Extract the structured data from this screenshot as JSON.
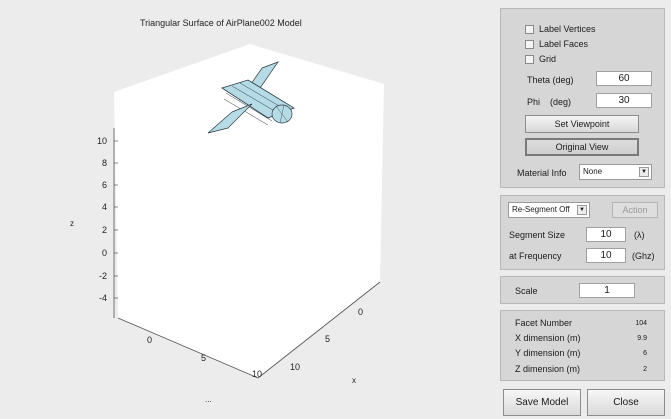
{
  "plot": {
    "title": "Triangular Surface of AirPlane002 Model",
    "z_label": "z",
    "x_label": "x",
    "y_label": "...",
    "z_ticks": [
      "10",
      "8",
      "6",
      "4",
      "2",
      "0",
      "-2",
      "-4"
    ],
    "x_ticks": [
      "0",
      "5",
      "10"
    ],
    "y_ticks": [
      "0",
      "5",
      "10"
    ],
    "fill_color": "#b4dbe6",
    "edge_color": "#2d3a40"
  },
  "view_panel": {
    "label_vertices": "Label Vertices",
    "label_faces": "Label Faces",
    "grid": "Grid",
    "theta_label": "Theta (deg)",
    "theta_value": "60",
    "phi_label": "Phi    (deg)",
    "phi_value": "30",
    "set_viewpoint": "Set Viewpoint",
    "original_view": "Original View",
    "material_label": "Material Info",
    "material_value": "None"
  },
  "segment_panel": {
    "resegment_value": "Re-Segment Off",
    "action": "Action",
    "segment_size_label": "Segment Size",
    "segment_size_value": "10",
    "segment_size_unit": "(λ)",
    "frequency_label": "at Frequency",
    "frequency_value": "10",
    "frequency_unit": "(Ghz)"
  },
  "scale_panel": {
    "label": "Scale",
    "value": "1"
  },
  "info_panel": {
    "facet_label": "Facet Number",
    "facet_value": "104",
    "x_label": "X dimension (m)",
    "x_value": "9.9",
    "y_label": "Y dimension (m)",
    "y_value": "6",
    "z_label": "Z dimension (m)",
    "z_value": "2"
  },
  "footer": {
    "save_model": "Save Model",
    "close": "Close"
  }
}
